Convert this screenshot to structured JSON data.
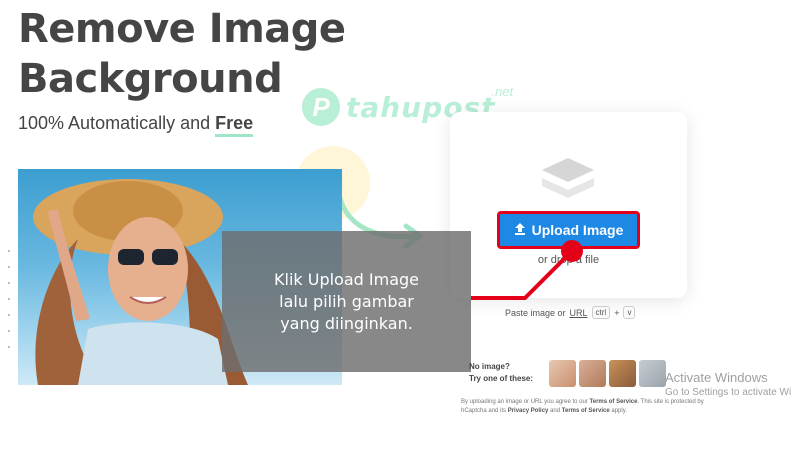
{
  "hero": {
    "title_line1": "Remove Image",
    "title_line2": "Background",
    "subtitle_prefix": "100% Automatically and ",
    "subtitle_emphasis": "Free"
  },
  "watermark": {
    "logo_letter": "P",
    "name": "tahupost",
    "tld": ".net"
  },
  "upload": {
    "icon": "layers-icon",
    "button_icon": "upload-arrow-icon",
    "button_label": "Upload Image",
    "drop_text": "or drop a file",
    "paste_prefix": "Paste image or ",
    "paste_link": "URL",
    "key_ctrl": "ctrl",
    "key_plus": "+",
    "key_v": "v"
  },
  "caption": {
    "text": "Klik Upload Image\nlalu pilih gambar\nyang diinginkan."
  },
  "samples": {
    "line1": "No image?",
    "line2": "Try one of these:",
    "thumb_colors": [
      "#c98f6e",
      "#b07a58",
      "#8a5a3a",
      "#9aa3ab"
    ]
  },
  "legal": {
    "part1": "By uploading an image or URL you agree to our ",
    "terms": "Terms of Service",
    "part2": ". This site is protected by hCaptcha and its ",
    "privacy": "Privacy Policy",
    "part3": " and ",
    "terms2": "Terms of Service",
    "part4": " apply."
  },
  "os": {
    "activate_title": "Activate Windows",
    "activate_sub": "Go to Settings to activate Wi"
  },
  "colors": {
    "accent_blue": "#1e88e5",
    "highlight_red": "#e5001a",
    "brand_mint": "#9fe6c6",
    "text_dark": "#454545"
  }
}
